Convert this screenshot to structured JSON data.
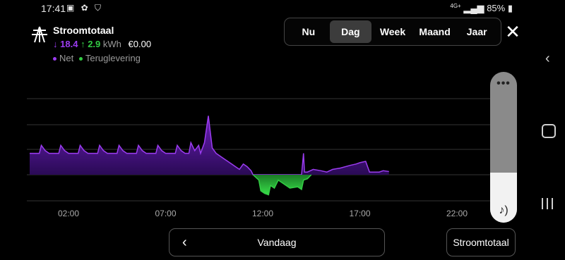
{
  "status_bar": {
    "time": "17:41",
    "left_icons": "▣ ✿ ⛉",
    "network": "4G+",
    "battery": "85%"
  },
  "header": {
    "title": "Stroomtotaal",
    "icon": "power-pylon-icon",
    "net_value": "18.4",
    "return_value": "2.9",
    "unit": "kWh",
    "cost": "€0.00",
    "legend_net": "Net",
    "legend_return": "Teruglevering"
  },
  "tabs": [
    {
      "label": "Nu",
      "active": false
    },
    {
      "label": "Dag",
      "active": true
    },
    {
      "label": "Week",
      "active": false
    },
    {
      "label": "Maand",
      "active": false
    },
    {
      "label": "Jaar",
      "active": false
    }
  ],
  "colors": {
    "net": "#9b3cf0",
    "return": "#33cc44"
  },
  "volume": {
    "level_percent": 33,
    "icon": "music-note-icon"
  },
  "footer": {
    "date_label": "Vandaag",
    "meter_label": "Stroomtotaal"
  },
  "chart_data": {
    "type": "area",
    "x_tick_labels": [
      "02:00",
      "07:00",
      "12:00",
      "17:00",
      "22:00"
    ],
    "x_ticks_hours": [
      2,
      7,
      12,
      17,
      22
    ],
    "xlim": [
      0,
      24
    ],
    "grid": true,
    "series": [
      {
        "name": "Net",
        "x": [
          0,
          0.5,
          0.6,
          0.8,
          1.0,
          1.5,
          1.6,
          1.8,
          2.0,
          2.5,
          2.6,
          2.8,
          3.0,
          3.5,
          3.6,
          3.8,
          4.0,
          4.5,
          4.6,
          4.8,
          5.0,
          5.5,
          5.6,
          5.8,
          6.0,
          6.5,
          6.6,
          6.8,
          7.0,
          7.5,
          7.6,
          7.8,
          8.0,
          8.2,
          8.3,
          8.5,
          8.7,
          8.8,
          9.0,
          9.2,
          9.4,
          9.6,
          10.0,
          10.4,
          10.6,
          10.8,
          11.0,
          11.2,
          11.4,
          11.5,
          14.0,
          14.1,
          14.15,
          14.3,
          14.6,
          15.0,
          15.3,
          15.6,
          16.0,
          16.5,
          16.8,
          17.0,
          17.3,
          17.5,
          18.0,
          18.2,
          18.5
        ],
        "y": [
          0.8,
          0.8,
          1.1,
          0.9,
          0.8,
          0.8,
          1.1,
          0.9,
          0.8,
          0.8,
          1.1,
          0.9,
          0.8,
          0.8,
          1.1,
          0.9,
          0.8,
          0.8,
          1.1,
          0.9,
          0.8,
          0.8,
          1.1,
          0.9,
          0.8,
          0.8,
          1.1,
          0.9,
          0.8,
          0.8,
          1.1,
          0.9,
          0.8,
          0.8,
          1.2,
          0.9,
          1.1,
          0.8,
          1.2,
          2.2,
          1.0,
          0.8,
          0.6,
          0.4,
          0.3,
          0.2,
          0.4,
          0.3,
          0.15,
          0.0,
          0.0,
          0.8,
          0.1,
          0.1,
          0.2,
          0.15,
          0.1,
          0.2,
          0.25,
          0.35,
          0.4,
          0.45,
          0.5,
          0.1,
          0.1,
          0.15,
          0.12
        ]
      },
      {
        "name": "Teruglevering",
        "x": [
          11.5,
          11.8,
          11.9,
          12.1,
          12.3,
          12.4,
          12.6,
          12.8,
          13.0,
          13.4,
          13.8,
          14.0,
          14.1,
          14.3,
          14.5
        ],
        "y": [
          0.0,
          -0.2,
          -0.6,
          -0.7,
          -0.75,
          -0.4,
          -0.5,
          -0.2,
          -0.3,
          -0.5,
          -0.45,
          -0.55,
          -0.2,
          -0.15,
          0.0
        ]
      }
    ]
  }
}
